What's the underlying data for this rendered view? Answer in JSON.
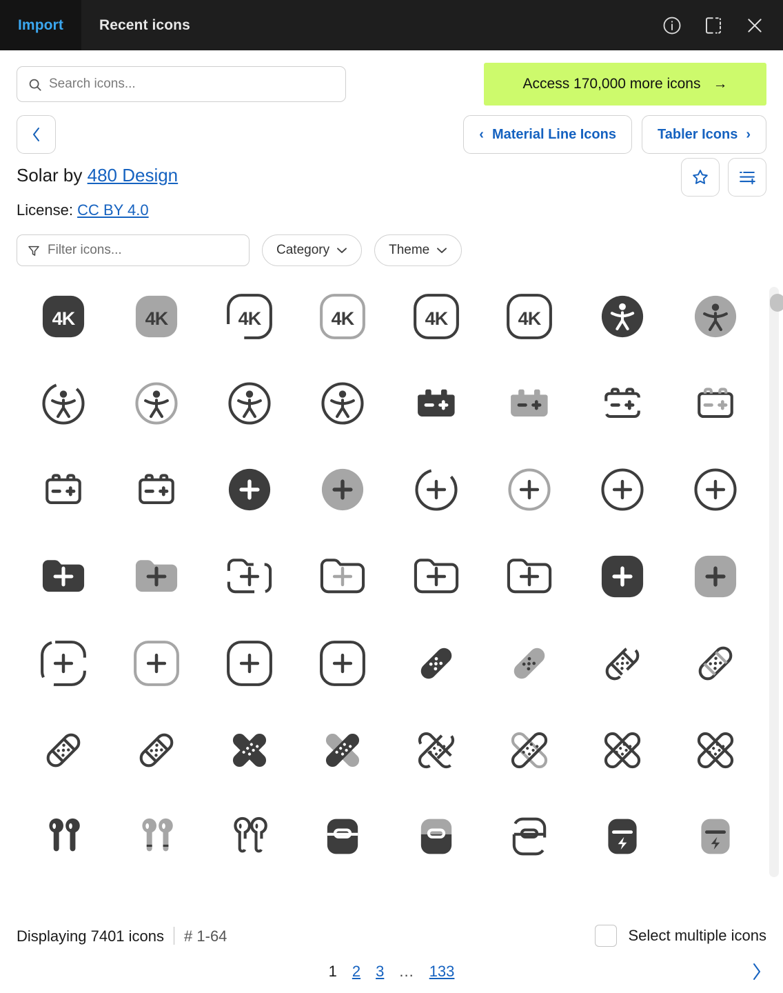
{
  "titlebar": {
    "tabs": [
      {
        "label": "Import",
        "active": true
      },
      {
        "label": "Recent icons",
        "active": false
      }
    ],
    "actions": [
      {
        "name": "info-icon",
        "label": "Info"
      },
      {
        "name": "panel-split-icon",
        "label": "Toggle panel"
      },
      {
        "name": "close-icon",
        "label": "Close"
      }
    ]
  },
  "search": {
    "placeholder": "Search icons...",
    "value": ""
  },
  "promo": {
    "label": "Access 170,000 more icons",
    "arrow": "→",
    "color": "#cdfa6c"
  },
  "nav": {
    "back_label": "‹",
    "prev_pack": "Material Line Icons",
    "next_pack": "Tabler Icons",
    "prev_chevron": "‹",
    "next_chevron": "›"
  },
  "pack": {
    "prefix": "Solar by ",
    "author": "480 Design",
    "license_label": "License:",
    "license_value": "CC BY 4.0",
    "actions": [
      {
        "name": "favorite-star-icon",
        "label": "Favorite"
      },
      {
        "name": "add-to-list-icon",
        "label": "Add to list"
      }
    ]
  },
  "filters": {
    "placeholder": "Filter icons...",
    "value": "",
    "category_label": "Category",
    "theme_label": "Theme",
    "chevron": "⌄"
  },
  "grid": {
    "rows": [
      [
        "4k-bold",
        "4k-bold-duotone",
        "4k-broken",
        "4k-line-duotone",
        "4k-linear",
        "4k-outline",
        "accessibility-bold",
        "accessibility-bold-duotone"
      ],
      [
        "accessibility-broken",
        "accessibility-line-duotone",
        "accessibility-linear",
        "accessibility-outline",
        "battery-bold",
        "battery-bold-duotone",
        "battery-broken",
        "battery-line-duotone"
      ],
      [
        "battery-linear",
        "battery-outline",
        "add-circle-bold",
        "add-circle-bold-duotone",
        "add-circle-broken",
        "add-circle-line-duotone",
        "add-circle-linear",
        "add-circle-outline"
      ],
      [
        "add-folder-bold",
        "add-folder-bold-duotone",
        "add-folder-broken",
        "add-folder-line-duotone",
        "add-folder-linear",
        "add-folder-outline",
        "add-square-bold",
        "add-square-bold-duotone"
      ],
      [
        "add-square-broken",
        "add-square-line-duotone",
        "add-square-linear",
        "add-square-outline",
        "plaster-bold",
        "plaster-bold-duotone",
        "plaster-broken",
        "plaster-line-duotone"
      ],
      [
        "plaster-linear",
        "plaster-outline",
        "plasters-bold",
        "plasters-bold-duotone",
        "plasters-broken",
        "plasters-line-duotone",
        "plasters-linear",
        "plasters-outline"
      ],
      [
        "airbuds-bold",
        "airbuds-bold-duotone",
        "airbuds-broken",
        "airbuds-case-bold",
        "airbuds-case-bold-duotone",
        "airbuds-case-broken",
        "airbuds-charge-bold",
        "airbuds-charge-bold-duotone"
      ]
    ],
    "colors": {
      "solid": "#3d3d3d",
      "muted": "#a6a6a6"
    }
  },
  "footer": {
    "displaying": "Displaying 7401 icons",
    "range": "# 1-64",
    "select_multiple": "Select multiple icons",
    "pages": [
      "1",
      "2",
      "3",
      "...",
      "133"
    ],
    "next_arrow": "›"
  }
}
